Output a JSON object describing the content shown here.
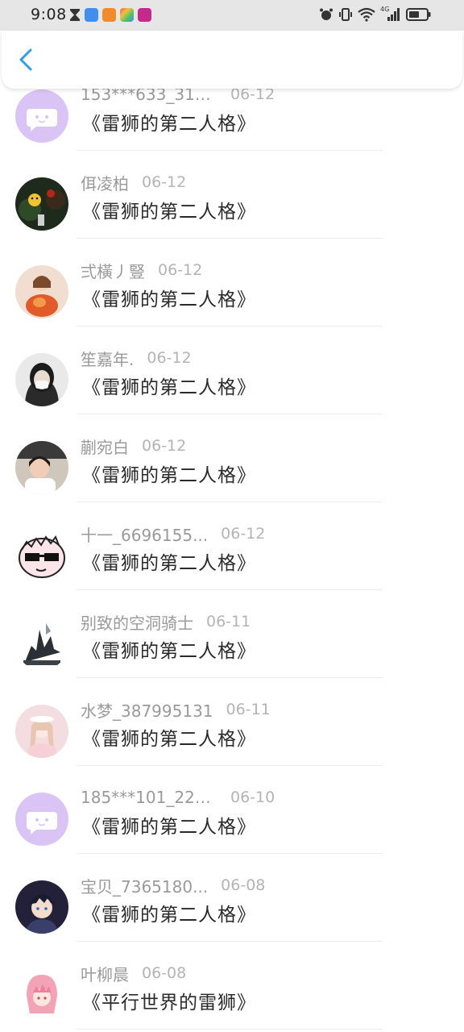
{
  "status_bar": {
    "time": "9:08",
    "network": "4G"
  },
  "header": {
    "back_label": "back"
  },
  "list": [
    {
      "user": "153***633_318...",
      "date": "06-12",
      "text": "《雷狮的第二人格》",
      "avatar": "chat-default"
    },
    {
      "user": "佴凌柏",
      "date": "06-12",
      "text": "《雷狮的第二人格》",
      "avatar": "emoji-plant"
    },
    {
      "user": "弍橫丿豎",
      "date": "06-12",
      "text": "《雷狮的第二人格》",
      "avatar": "anime-girl-orange"
    },
    {
      "user": "笙嘉年.",
      "date": "06-12",
      "text": "《雷狮的第二人格》",
      "avatar": "masked-person"
    },
    {
      "user": "蒯宛白",
      "date": "06-12",
      "text": "《雷狮的第二人格》",
      "avatar": "child-photo"
    },
    {
      "user": "十一_6696155...",
      "date": "06-12",
      "text": "《雷狮的第二人格》",
      "avatar": "sunglasses-face"
    },
    {
      "user": "别致的空洞骑士",
      "date": "06-11",
      "text": "《雷狮的第二人格》",
      "avatar": "ship-art"
    },
    {
      "user": "水梦_387995131",
      "date": "06-11",
      "text": "《雷狮的第二人格》",
      "avatar": "pink-girl"
    },
    {
      "user": "185***101_221...",
      "date": "06-10",
      "text": "《雷狮的第二人格》",
      "avatar": "chat-default"
    },
    {
      "user": "宝贝_7365180...",
      "date": "06-08",
      "text": "《雷狮的第二人格》",
      "avatar": "anime-boy"
    },
    {
      "user": "叶柳晨",
      "date": "06-08",
      "text": "《平行世界的雷狮》",
      "avatar": "pink-hair-anime"
    }
  ],
  "colors": {
    "accent": "#2e9fe6",
    "default_avatar_bg": "#d9c4f5",
    "username": "#9a9a9a",
    "date": "#b4b4b4",
    "content": "#2a2a2a"
  }
}
